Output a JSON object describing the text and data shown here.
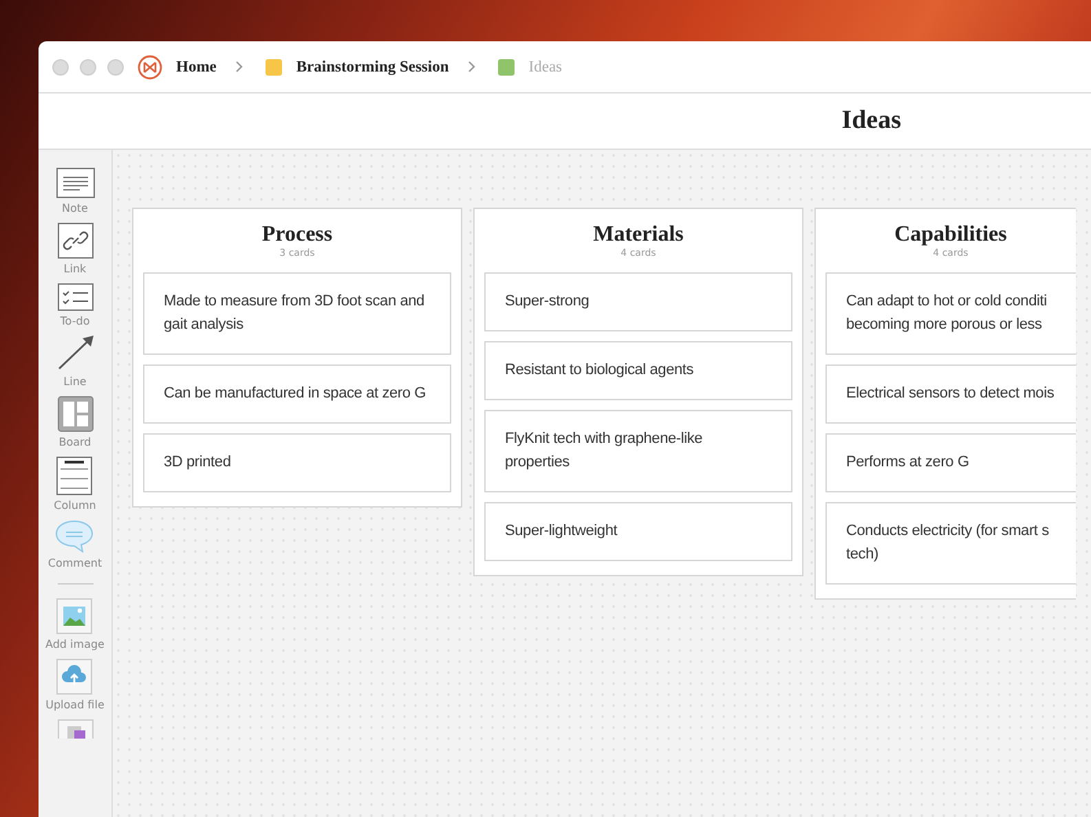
{
  "breadcrumbs": [
    {
      "label": "Home",
      "kind": "home",
      "selected": false
    },
    {
      "label": "Brainstorming Session",
      "kind": "board",
      "color": "#f7c548",
      "selected": false
    },
    {
      "label": "Ideas",
      "kind": "board",
      "color": "#8fc46a",
      "selected": true
    }
  ],
  "title": "Ideas",
  "toolbar": [
    {
      "label": "Note",
      "kind": "note"
    },
    {
      "label": "Link",
      "kind": "link"
    },
    {
      "label": "To-do",
      "kind": "todo"
    },
    {
      "label": "Line",
      "kind": "line"
    },
    {
      "label": "Board",
      "kind": "board"
    },
    {
      "label": "Column",
      "kind": "column"
    },
    {
      "label": "Comment",
      "kind": "comment"
    },
    {
      "kind": "divider"
    },
    {
      "label": "Add image",
      "kind": "image"
    },
    {
      "label": "Upload file",
      "kind": "upload"
    },
    {
      "kind": "more"
    }
  ],
  "columns": [
    {
      "title": "Process",
      "count": "3 cards",
      "cards": [
        [
          "Made to measure from 3D foot scan and",
          "gait analysis"
        ],
        [
          "Can be manufactured in space at zero G"
        ],
        [
          "3D printed"
        ]
      ]
    },
    {
      "title": "Materials",
      "count": "4 cards",
      "cards": [
        [
          "Super-strong"
        ],
        [
          "Resistant to biological agents"
        ],
        [
          "FlyKnit tech with graphene-like",
          "properties"
        ],
        [
          "Super-lightweight"
        ]
      ]
    },
    {
      "title": "Capabilities",
      "count": "4 cards",
      "cards": [
        [
          "Can adapt to hot or cold conditi",
          "becoming more porous or less"
        ],
        [
          "Electrical sensors to detect mois"
        ],
        [
          "Performs at zero G"
        ],
        [
          "Conducts electricity (for smart s",
          "tech)"
        ]
      ]
    }
  ]
}
